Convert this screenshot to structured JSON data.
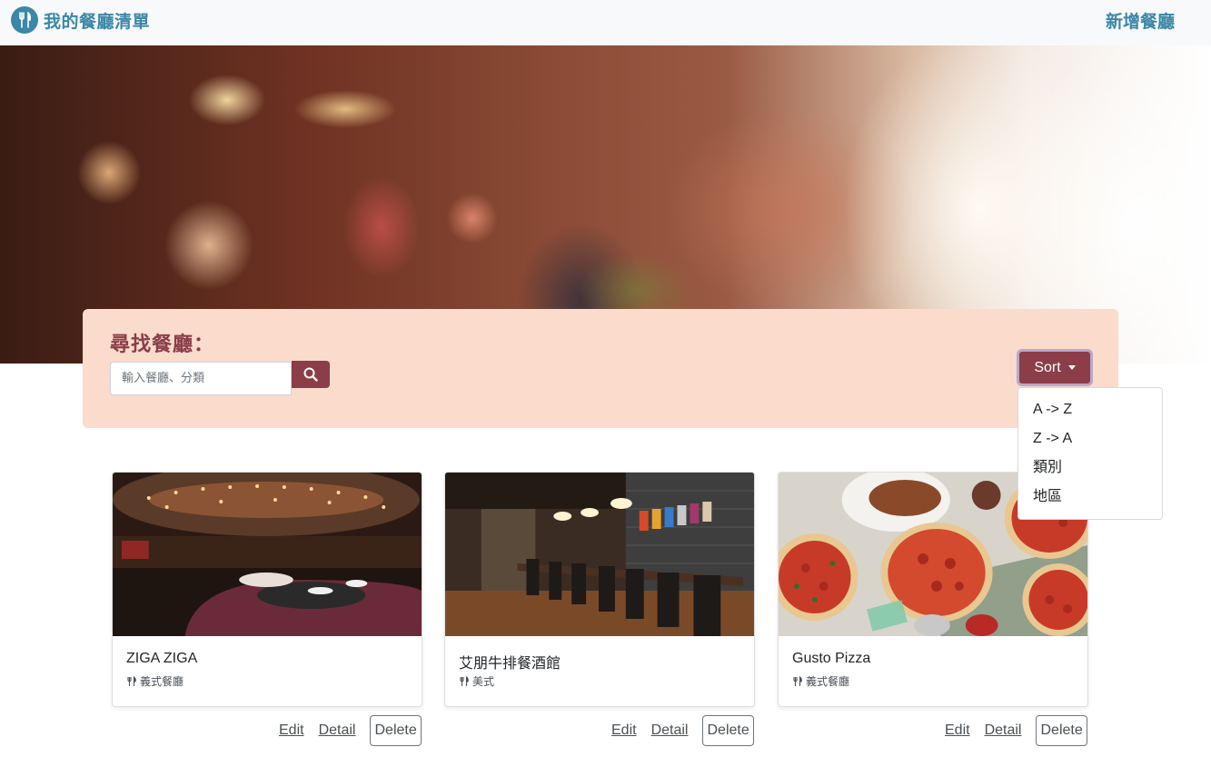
{
  "navbar": {
    "brand_text": "我的餐廳清單",
    "brand_icon": "utensils-icon",
    "add_label": "新增餐廳"
  },
  "search": {
    "title": "尋找餐廳：",
    "placeholder": "輸入餐廳、分類",
    "button_icon": "search-icon"
  },
  "sort": {
    "label": "Sort",
    "options": [
      "A -> Z",
      "Z -> A",
      "類別",
      "地區"
    ]
  },
  "colors": {
    "brand": "#3a87a8",
    "accent": "#8b3d48",
    "panel": "#fadbcc"
  },
  "restaurants": [
    {
      "name": "ZIGA ZIGA",
      "category": "義式餐廳",
      "image_icon": "restaurant-photo"
    },
    {
      "name": "艾朋牛排餐酒館",
      "category": "美式",
      "image_icon": "restaurant-photo"
    },
    {
      "name": "Gusto Pizza",
      "category": "義式餐廳",
      "image_icon": "pizza-photo"
    }
  ],
  "actions": {
    "edit": "Edit",
    "detail": "Detail",
    "delete": "Delete"
  }
}
